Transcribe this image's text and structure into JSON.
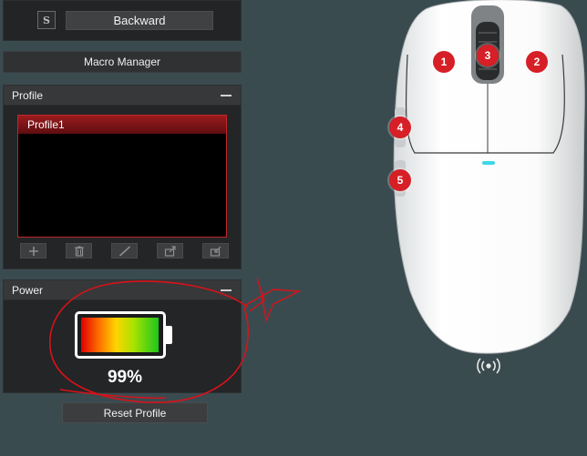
{
  "button_row": {
    "key": "S",
    "action": "Backward"
  },
  "macro_manager": {
    "label": "Macro Manager"
  },
  "profile": {
    "title": "Profile",
    "items": [
      "Profile1"
    ],
    "tools": [
      "add-icon",
      "delete-icon",
      "rename-icon",
      "export-icon",
      "import-icon"
    ]
  },
  "power": {
    "title": "Power",
    "percent_text": "99%",
    "level": 0.99
  },
  "reset": {
    "label": "Reset Profile"
  },
  "mouse": {
    "buttons": [
      "1",
      "2",
      "3",
      "4",
      "5"
    ]
  },
  "colors": {
    "accent": "#d61f26",
    "background": "#3a4b50"
  }
}
